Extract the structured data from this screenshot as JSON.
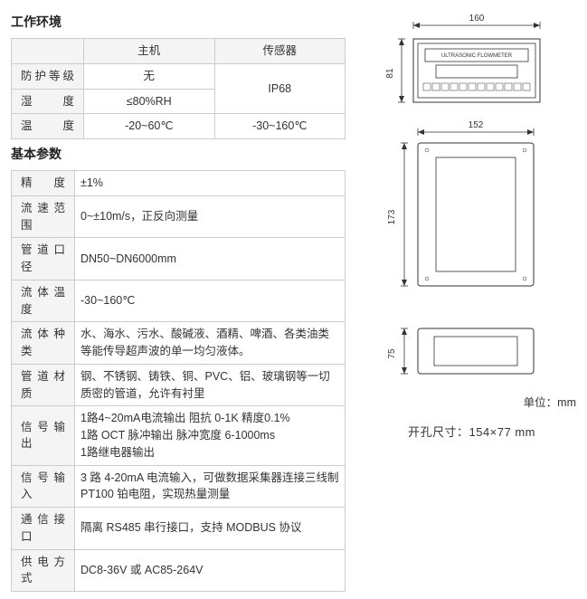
{
  "section_env": {
    "title": "工作环境",
    "headers": {
      "host": "主机",
      "sensor": "传感器"
    },
    "rows": {
      "protection": {
        "label": "防护等级",
        "host": "无",
        "sensor_merged": "IP68"
      },
      "humidity": {
        "label": "湿 度",
        "host": "≤80%RH"
      },
      "temperature": {
        "label": "温 度",
        "host": "-20~60℃",
        "sensor": "-30~160℃"
      }
    }
  },
  "section_params": {
    "title": "基本参数",
    "rows": {
      "accuracy": {
        "label": "精 度",
        "value": "±1%"
      },
      "flow_range": {
        "label": "流速范围",
        "value": "0~±10m/s，正反向测量"
      },
      "pipe_dn": {
        "label": "管道口径",
        "value": "DN50~DN6000mm"
      },
      "fluid_temp": {
        "label": "流体温度",
        "value": "-30~160℃"
      },
      "fluid_type": {
        "label": "流体种类",
        "value": "水、海水、污水、酸碱液、酒精、啤酒、各类油类等能传导超声波的单一均匀液体。"
      },
      "pipe_mat": {
        "label": "管道材质",
        "value": "钢、不锈钢、铸铁、铜、PVC、铝、玻璃钢等一切质密的管道，允许有衬里"
      },
      "sig_out": {
        "label": "信号输出",
        "value": "1路4~20mA电流输出 阻抗 0-1K 精度0.1%\n1路 OCT 脉冲输出 脉冲宽度 6-1000ms\n1路继电器输出"
      },
      "sig_in": {
        "label": "信号输入",
        "value": "3 路 4-20mA 电流输入，可做数据采集器连接三线制 PT100 铂电阻，实现热量测量"
      },
      "comm": {
        "label": "通信接口",
        "value": "隔离 RS485 串行接口，支持 MODBUS 协议"
      },
      "power": {
        "label": "供电方式",
        "value": "DC8-36V 或 AC85-264V"
      }
    }
  },
  "diagram": {
    "device_label": "ULTRASONIC FLOWMETER",
    "dim_w1": "160",
    "dim_h1": "81",
    "dim_w2": "152",
    "dim_h2": "173",
    "dim_h3": "75",
    "unit_label": "单位：mm",
    "cutout_label": "开孔尺寸：154×77 mm"
  }
}
